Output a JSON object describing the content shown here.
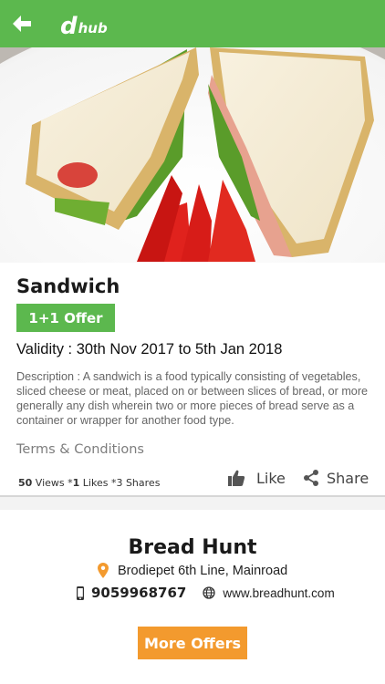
{
  "header": {
    "logo_d": "d",
    "logo_hub": "hub",
    "back_icon": "arrow-left-icon",
    "bar_color": "#5cb84e"
  },
  "offer": {
    "title": "Sandwich",
    "badge": "1+1 Offer",
    "validity": "Validity : 30th Nov 2017 to 5th Jan 2018",
    "description": "Description : A sandwich is a food typically consisting of vegetables, sliced cheese or meat, placed on or between slices of bread, or more generally any dish wherein two or more pieces of bread serve as a container or wrapper for another food type.",
    "terms": "Terms & Conditions"
  },
  "stats": {
    "views_count": "50",
    "views_label": " Views *",
    "likes_count": "1",
    "likes_label": "  Likes *3 Shares"
  },
  "actions": {
    "like": "Like",
    "share": "Share"
  },
  "store": {
    "name": "Bread Hunt",
    "address": "Brodiepet 6th Line, Mainroad",
    "phone": "9059968767",
    "website": "www.breadhunt.com"
  },
  "footer": {
    "more_offers": "More Offers",
    "button_color": "#f39a2e"
  }
}
